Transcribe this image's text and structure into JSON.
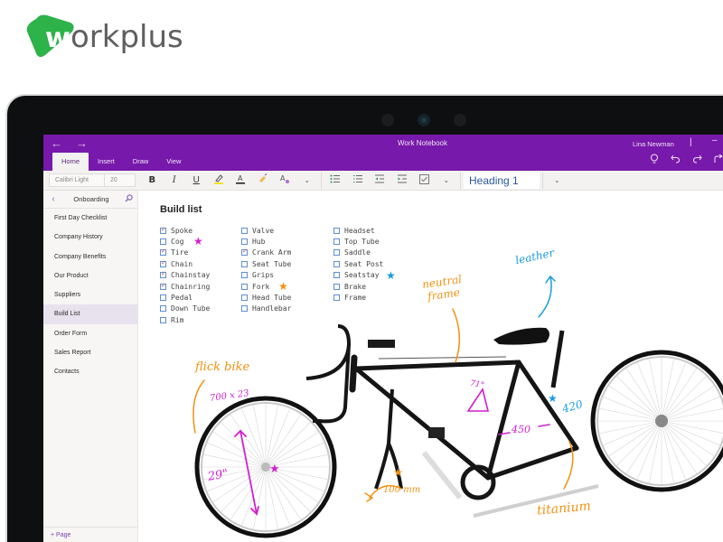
{
  "brand": {
    "logo_mark": "w",
    "logo_text": "orkplus",
    "color": "#2eb24a"
  },
  "window": {
    "title": "Work Notebook",
    "user": "Lina Newman",
    "back_icon": "←",
    "forward_icon": "→",
    "minimize_icon": "–"
  },
  "ribbon": {
    "tabs": [
      "Home",
      "Insert",
      "Draw",
      "View"
    ],
    "active_tab": "Home",
    "right_icons": [
      "lightbulb-icon",
      "undo-icon",
      "redo-icon",
      "share-icon"
    ]
  },
  "toolbar": {
    "font_name": "Calibri Light",
    "font_size": "20",
    "bold": "B",
    "italic": "I",
    "underline": "U",
    "style": "Heading 1"
  },
  "sidebar": {
    "section": "Onboarding",
    "pages": [
      "First Day Checklist",
      "Company History",
      "Company Benefits",
      "Our Product",
      "Suppliers",
      "Build List",
      "Order Form",
      "Sales Report",
      "Contacts"
    ],
    "active_page": "Build List",
    "add_page": "+ Page"
  },
  "page": {
    "title": "Build list",
    "columns": [
      [
        {
          "label": "Spoke",
          "checked": true
        },
        {
          "label": "Cog",
          "checked": false
        },
        {
          "label": "Tire",
          "checked": true
        },
        {
          "label": "Chain",
          "checked": true
        },
        {
          "label": "Chainstay",
          "checked": true
        },
        {
          "label": "Chainring",
          "checked": true
        },
        {
          "label": "Pedal",
          "checked": false
        },
        {
          "label": "Down Tube",
          "checked": false
        },
        {
          "label": "Rim",
          "checked": false
        }
      ],
      [
        {
          "label": "Valve",
          "checked": false
        },
        {
          "label": "Hub",
          "checked": false
        },
        {
          "label": "Crank Arm",
          "checked": true
        },
        {
          "label": "Seat Tube",
          "checked": false
        },
        {
          "label": "Grips",
          "checked": false
        },
        {
          "label": "Fork",
          "checked": false
        },
        {
          "label": "Head Tube",
          "checked": false
        },
        {
          "label": "Handlebar",
          "checked": false
        }
      ],
      [
        {
          "label": "Headset",
          "checked": false
        },
        {
          "label": "Top Tube",
          "checked": false
        },
        {
          "label": "Saddle",
          "checked": false
        },
        {
          "label": "Seat Post",
          "checked": false
        },
        {
          "label": "Seatstay",
          "checked": false
        },
        {
          "label": "Brake",
          "checked": false
        },
        {
          "label": "Frame",
          "checked": false
        }
      ]
    ],
    "annotations": {
      "flick_bike": "flick bike",
      "tire_size": "700 x 23",
      "wheel_size": "29\"",
      "neutral_frame": "neutral frame",
      "leather": "leather",
      "angle": "71°",
      "tube_length": "450",
      "seatstay_length": "420",
      "fork_width": "100 mm",
      "titanium": "titanium"
    },
    "ink_colors": {
      "magenta": "#d11fd1",
      "orange": "#f29111",
      "blue": "#1a9be0"
    }
  }
}
